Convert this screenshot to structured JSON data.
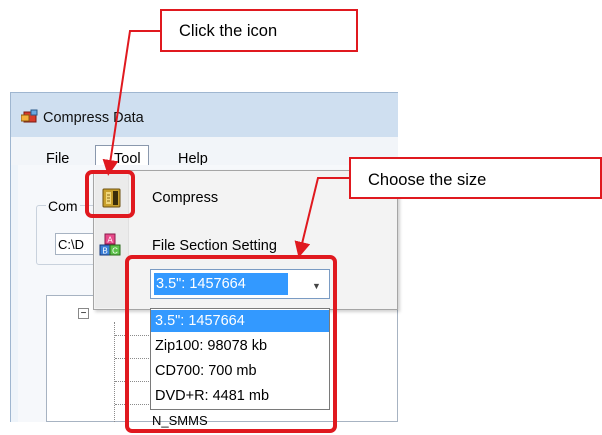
{
  "window": {
    "title": "Compress Data",
    "menu": {
      "file": "File",
      "tool": "Tool",
      "help": "Help"
    },
    "group_label": "Com",
    "path_value": "C:\\D",
    "tree_node": "N_SMMS"
  },
  "tool_menu": {
    "compress": {
      "label": "Compress",
      "icon": "compress-icon"
    },
    "file_section": {
      "label": "File Section Setting",
      "icon": "abc-blocks-icon"
    }
  },
  "size_combo": {
    "value": "3.5\":   1457664",
    "options": [
      "3.5\":   1457664",
      "Zip100:  98078 kb",
      "CD700: 700 mb",
      "DVD+R: 4481 mb"
    ],
    "selected_index": 0
  },
  "annotations": {
    "click_icon": "Click the icon",
    "choose_size": "Choose the size",
    "color": "#e0191f"
  }
}
